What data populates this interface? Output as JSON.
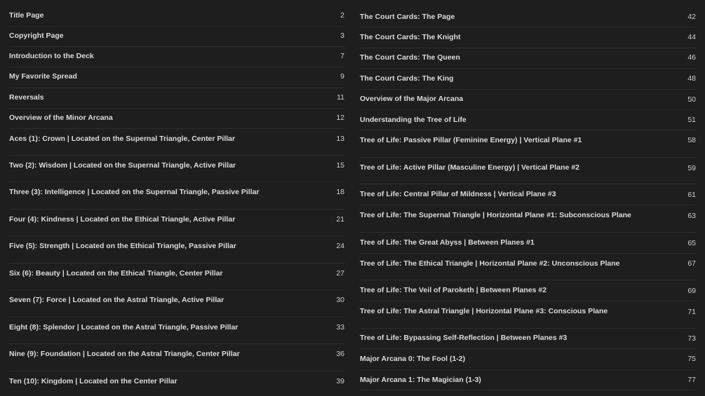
{
  "toc": {
    "left": [
      {
        "title": "Title Page",
        "page": "2"
      },
      {
        "title": "Copyright Page",
        "page": "3"
      },
      {
        "title": "Introduction to the Deck",
        "page": "7"
      },
      {
        "title": "My Favorite Spread",
        "page": "9"
      },
      {
        "title": "Reversals",
        "page": "11"
      },
      {
        "title": "Overview of the Minor Arcana",
        "page": "12"
      },
      {
        "title": "Aces (1): Crown | Located on the Supernal Triangle, Center Pillar",
        "page": "13"
      },
      {
        "title": "Two (2): Wisdom | Located on the Supernal Triangle, Active Pillar",
        "page": "15"
      },
      {
        "title": "Three (3): Intelligence | Located on the Supernal Triangle, Passive Pillar",
        "page": "18"
      },
      {
        "title": "Four (4): Kindness | Located on the Ethical Triangle, Active Pillar",
        "page": "21"
      },
      {
        "title": "Five (5): Strength | Located on the Ethical Triangle, Passive Pillar",
        "page": "24"
      },
      {
        "title": "Six (6): Beauty | Located on the Ethical Triangle, Center Pillar",
        "page": "27"
      },
      {
        "title": "Seven (7): Force | Located on the Astral Triangle, Active Pillar",
        "page": "30"
      },
      {
        "title": "Eight (8): Splendor | Located on the Astral Triangle, Passive Pillar",
        "page": "33"
      },
      {
        "title": "Nine (9): Foundation | Located on the Astral Triangle, Center Pillar",
        "page": "36"
      },
      {
        "title": "Ten (10): Kingdom | Located on the Center Pillar",
        "page": "39"
      }
    ],
    "right": [
      {
        "title": "The Court Cards: The Page",
        "page": "42"
      },
      {
        "title": "The Court Cards: The Knight",
        "page": "44"
      },
      {
        "title": "The Court Cards: The Queen",
        "page": "46"
      },
      {
        "title": "The Court Cards: The King",
        "page": "48"
      },
      {
        "title": "Overview of the Major Arcana",
        "page": "50"
      },
      {
        "title": "Understanding the Tree of Life",
        "page": "51"
      },
      {
        "title": "Tree of Life: Passive Pillar (Feminine Energy) | Vertical Plane #1",
        "page": "58"
      },
      {
        "title": "Tree of Life: Active Pillar (Masculine Energy) | Vertical Plane #2",
        "page": "59"
      },
      {
        "title": "Tree of Life: Central Pillar of Mildness | Vertical Plane #3",
        "page": "61"
      },
      {
        "title": "Tree of Life: The Supernal Triangle | Horizontal Plane #1: Subconscious Plane",
        "page": "63"
      },
      {
        "title": "Tree of Life: The Great Abyss | Between Planes #1",
        "page": "65"
      },
      {
        "title": "Tree of Life: The Ethical Triangle | Horizontal Plane #2: Unconscious Plane",
        "page": "67"
      },
      {
        "title": "Tree of Life: The Veil of Paroketh | Between Planes #2",
        "page": "69"
      },
      {
        "title": "Tree of Life: The Astral Triangle | Horizontal Plane #3: Conscious Plane",
        "page": "71"
      },
      {
        "title": "Tree of Life: Bypassing Self-Reflection | Between Planes #3",
        "page": "73"
      },
      {
        "title": "Major Arcana 0: The Fool (1-2)",
        "page": "75"
      },
      {
        "title": "Major Arcana 1: The Magician (1-3)",
        "page": "77"
      }
    ]
  }
}
